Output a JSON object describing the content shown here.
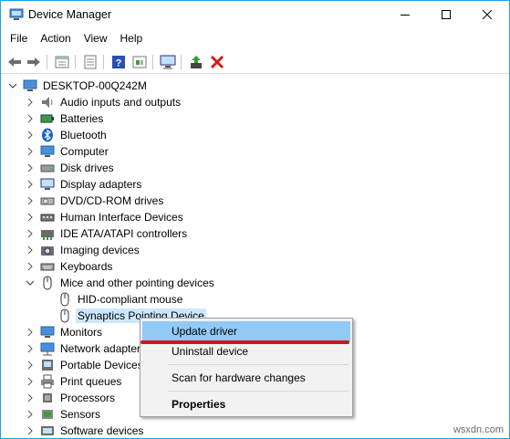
{
  "window": {
    "title": "Device Manager",
    "accent": "#1ba1e2"
  },
  "menu": [
    "File",
    "Action",
    "View",
    "Help"
  ],
  "toolbar": {
    "buttons": [
      "back-icon",
      "forward-icon",
      "properties-icon",
      "driver-details-icon",
      "help-icon",
      "scan-hardware-icon",
      "monitor-icon",
      "update-driver-icon",
      "uninstall-icon"
    ]
  },
  "tree": {
    "root": "DESKTOP-00Q242M",
    "categories": [
      "Audio inputs and outputs",
      "Batteries",
      "Bluetooth",
      "Computer",
      "Disk drives",
      "Display adapters",
      "DVD/CD-ROM drives",
      "Human Interface Devices",
      "IDE ATA/ATAPI controllers",
      "Imaging devices",
      "Keyboards",
      "Mice and other pointing devices",
      "Monitors",
      "Network adapters",
      "Portable Devices",
      "Print queues",
      "Processors",
      "Sensors",
      "Software devices"
    ],
    "mice_children": [
      "HID-compliant mouse",
      "Synaptics Pointing Device"
    ]
  },
  "context_menu": {
    "update_driver": "Update driver",
    "uninstall_device": "Uninstall device",
    "scan": "Scan for hardware changes",
    "properties": "Properties"
  },
  "watermark": "wsxdn.com"
}
